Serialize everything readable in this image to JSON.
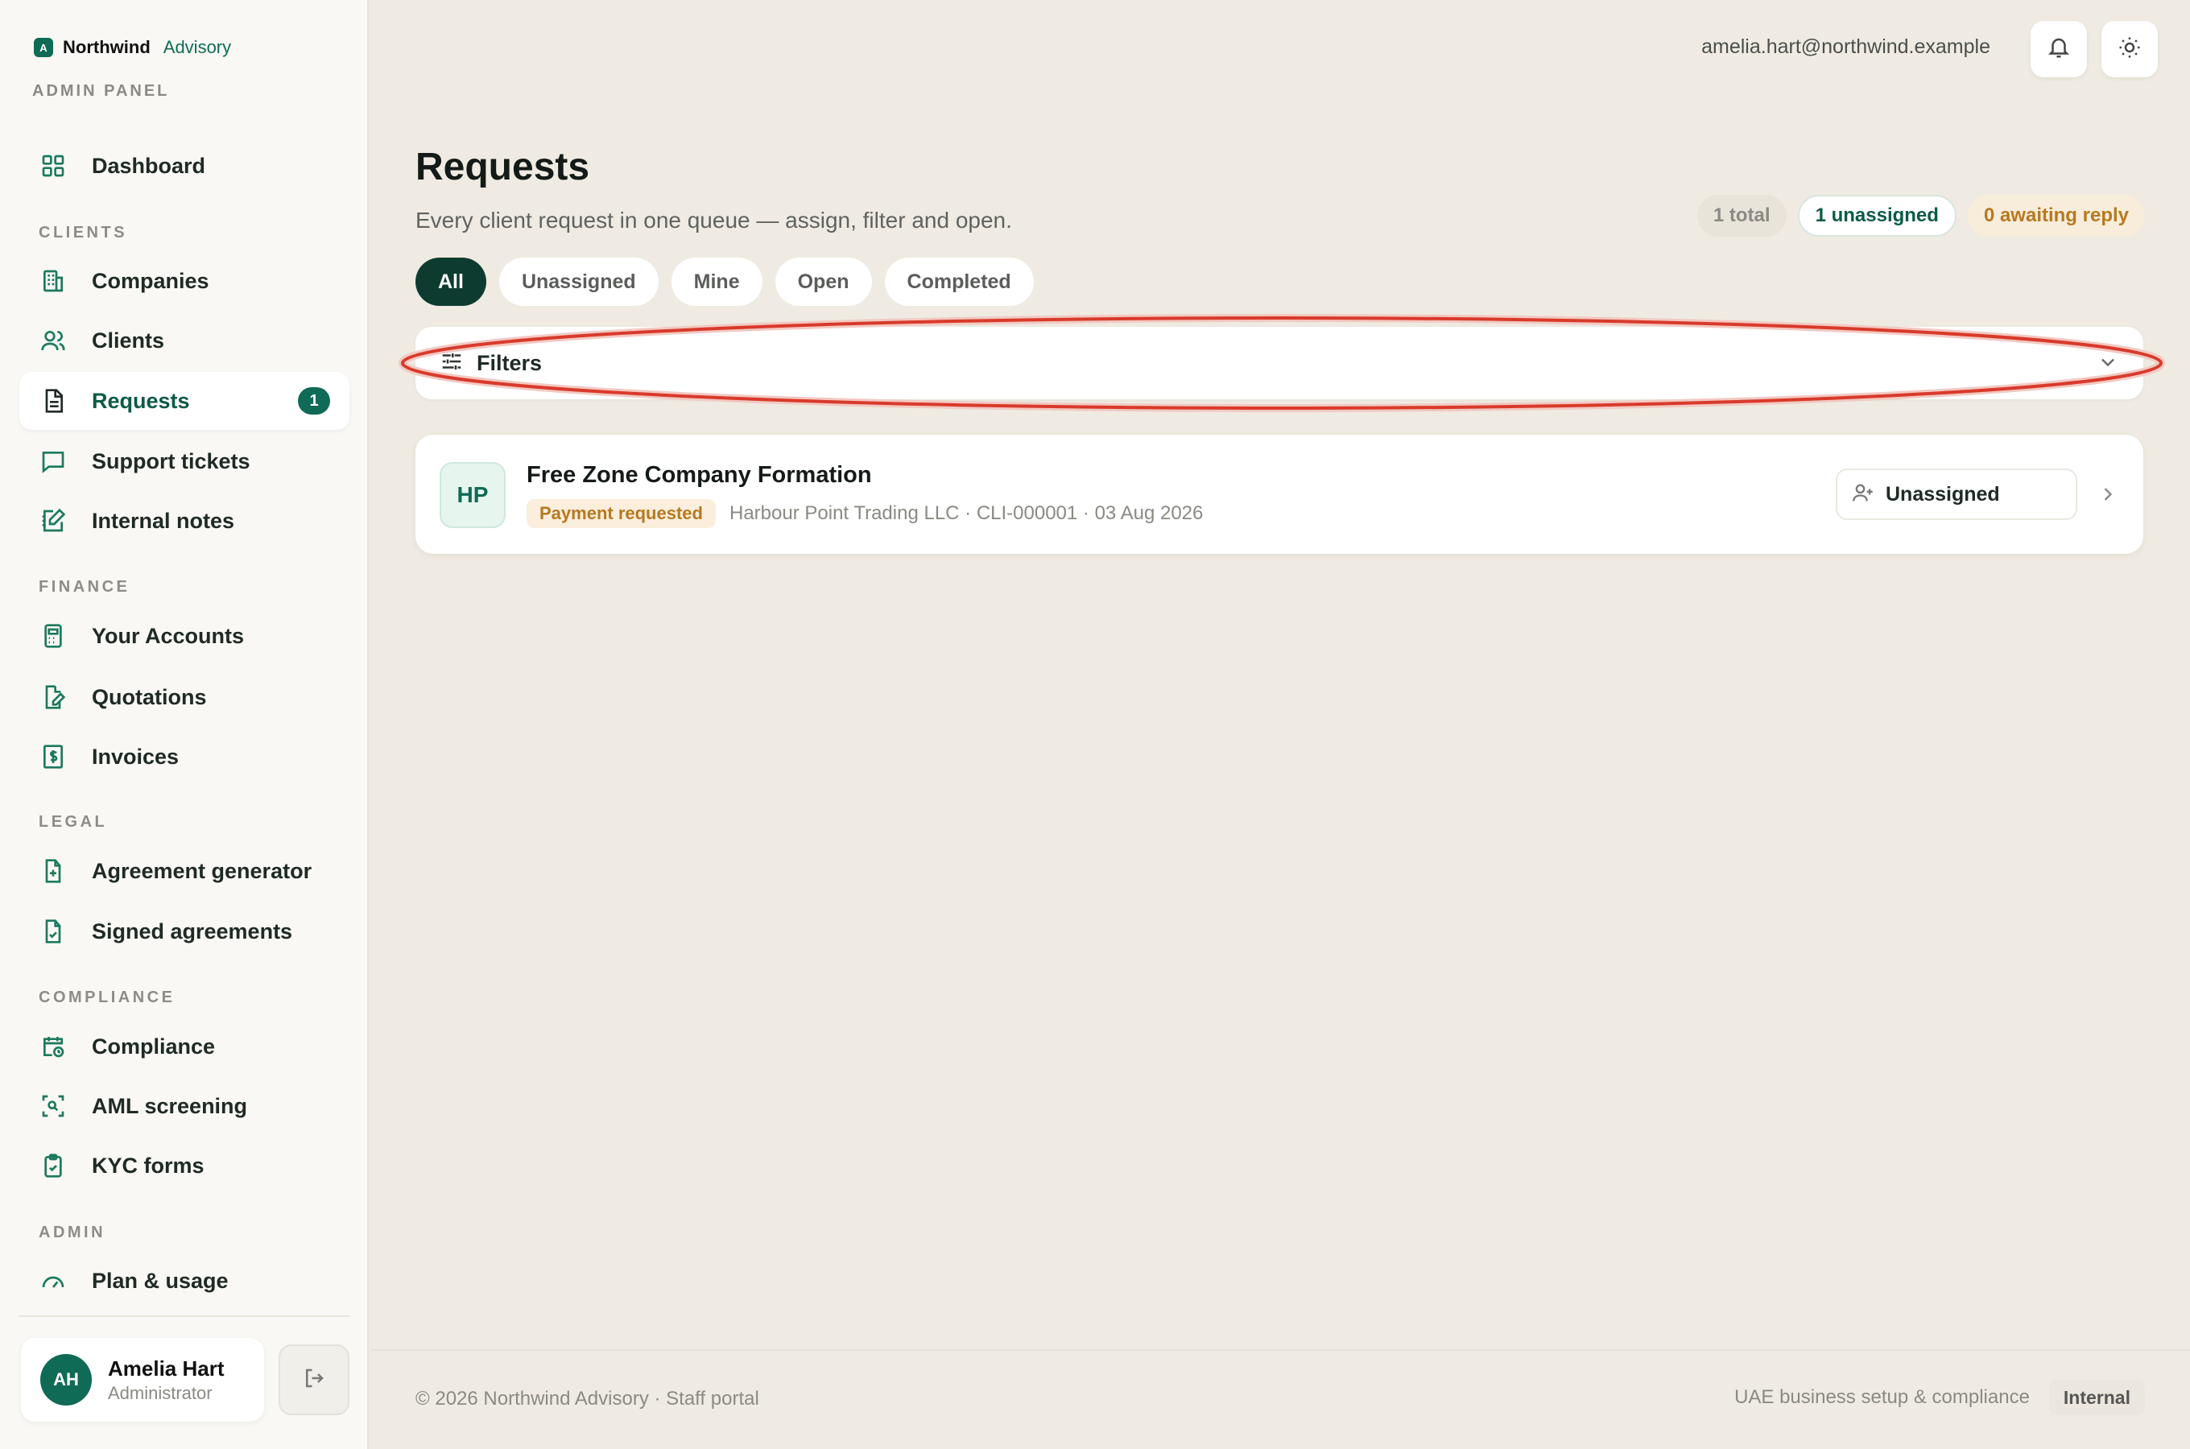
{
  "brand": {
    "logo_letter": "A",
    "name": "Northwind",
    "sub": "Advisory",
    "panel_label": "ADMIN PANEL"
  },
  "sidebar": {
    "sections": [
      "CLIENTS",
      "FINANCE",
      "LEGAL",
      "COMPLIANCE",
      "ADMIN"
    ],
    "items": [
      {
        "label": "Dashboard",
        "icon": "grid-icon"
      },
      {
        "label": "Companies",
        "icon": "building-icon"
      },
      {
        "label": "Clients",
        "icon": "users-icon"
      },
      {
        "label": "Requests",
        "icon": "document-icon",
        "badge": "1",
        "active": true
      },
      {
        "label": "Support tickets",
        "icon": "chat-icon"
      },
      {
        "label": "Internal notes",
        "icon": "note-edit-icon"
      },
      {
        "label": "Your Accounts",
        "icon": "calculator-icon"
      },
      {
        "label": "Quotations",
        "icon": "file-edit-icon"
      },
      {
        "label": "Invoices",
        "icon": "dollar-receipt-icon"
      },
      {
        "label": "Agreement generator",
        "icon": "file-plus-icon"
      },
      {
        "label": "Signed agreements",
        "icon": "file-check-icon"
      },
      {
        "label": "Compliance",
        "icon": "calendar-clock-icon"
      },
      {
        "label": "AML screening",
        "icon": "scan-search-icon"
      },
      {
        "label": "KYC forms",
        "icon": "clipboard-check-icon"
      },
      {
        "label": "Plan & usage",
        "icon": "gauge-icon"
      }
    ]
  },
  "user": {
    "initials": "AH",
    "name": "Amelia Hart",
    "role": "Administrator",
    "email": "amelia.hart@northwind.example"
  },
  "page": {
    "title": "Requests",
    "subtitle": "Every client request in one queue — assign, filter and open.",
    "stats": {
      "total": "1 total",
      "unassigned": "1 unassigned",
      "awaiting": "0 awaiting reply"
    },
    "tabs": [
      "All",
      "Unassigned",
      "Mine",
      "Open",
      "Completed"
    ],
    "filters_label": "Filters"
  },
  "requests": [
    {
      "initials": "HP",
      "title": "Free Zone Company Formation",
      "status": "Payment requested",
      "meta": "Harbour Point Trading LLC · CLI-000001 · 03 Aug 2026",
      "assignee": "Unassigned"
    }
  ],
  "footer": {
    "copyright": "© 2026 Northwind Advisory · Staff portal",
    "tagline": "UAE business setup & compliance",
    "badge": "Internal"
  },
  "colors": {
    "accent": "#0f6b55",
    "dark_tab": "#0d3b2f",
    "warning": "#b7791f",
    "highlight": "#d93a2b"
  }
}
